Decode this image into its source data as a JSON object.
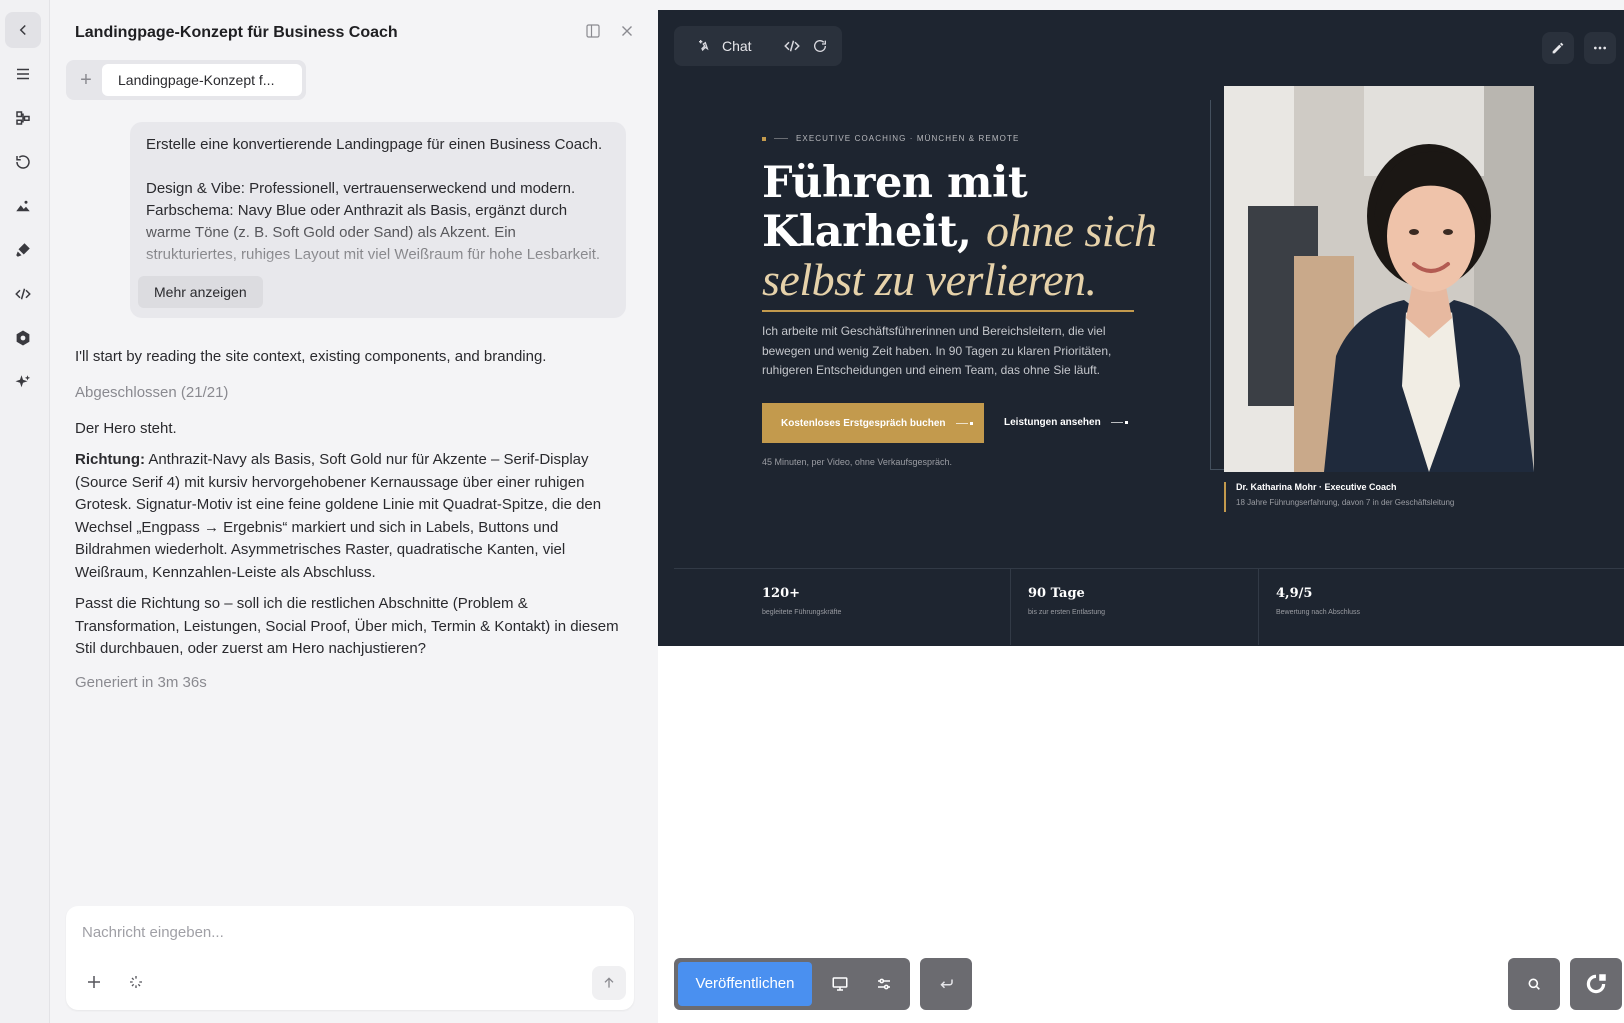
{
  "chat": {
    "title": "Landingpage-Konzept für Business Coach",
    "tab_label": "Landingpage-Konzept f...",
    "user_message": {
      "p1": "Erstelle eine konvertierende Landingpage für einen Business Coach.",
      "p2": "Design & Vibe: Professionell, vertrauenserweckend und modern. Farbschema: Navy Blue oder Anthrazit als Basis, ergänzt durch warme Töne (z. B. Soft Gold oder Sand) als Akzent. Ein strukturiertes, ruhiges Layout mit viel Weißraum für hohe Lesbarkeit.",
      "more_label": "Mehr anzeigen"
    },
    "assistant": {
      "intro": "I'll start by reading the site context, existing components, and branding.",
      "status": "Abgeschlossen (21/21)",
      "hero_done": "Der Hero steht.",
      "direction_label": "Richtung:",
      "direction_text": " Anthrazit-Navy als Basis, Soft Gold nur für Akzente – Serif-Display (Source Serif 4) mit kursiv hervorgehobener Kernaussage über einer ruhigen Grotesk. Signatur-Motiv ist eine feine goldene Linie mit Quadrat-Spitze, die den Wechsel „Engpass → Ergebnis“ markiert und sich in Labels, Buttons und Bildrahmen wiederholt. Asymmetrisches Raster, quadratische Kanten, viel Weißraum, Kennzahlen-Leiste als Abschluss.",
      "question": "Passt die Richtung so – soll ich die restlichen Abschnitte (Problem & Transformation, Leistungen, Social Proof, Über mich, Termin & Kontakt) in diesem Stil durchbauen, oder zuerst am Hero nachjustieren?",
      "generated": "Generiert in 3m 36s"
    },
    "composer": {
      "placeholder": "Nachricht eingeben..."
    }
  },
  "preview_toolbar": {
    "chat_label": "Chat"
  },
  "hero": {
    "eyebrow": "EXECUTIVE COACHING · MÜNCHEN & REMOTE",
    "headline_line1": "Führen mit",
    "headline_line2_plain": "Klarheit, ",
    "headline_line2_accent": "ohne sich",
    "headline_line3_accent": "selbst zu verlieren.",
    "lead": "Ich arbeite mit Geschäftsführerinnen und Bereichsleitern, die viel bewegen und wenig Zeit haben. In 90 Tagen zu klaren Prioritäten, ruhigeren Entscheidungen und einem Team, das ohne Sie läuft.",
    "cta_primary": "Kostenloses Erstgespräch buchen",
    "cta_secondary": "Leistungen ansehen",
    "fineprint": "45 Minuten, per Video, ohne Verkaufsgespräch.",
    "caption_name": "Dr. Katharina Mohr · Executive Coach",
    "caption_sub": "18 Jahre Führungserfahrung, davon 7 in der Geschäftsleitung",
    "stats": [
      {
        "value": "120+",
        "label": "begleitete Führungskräfte"
      },
      {
        "value": "90 Tage",
        "label": "bis zur ersten Entlastung"
      },
      {
        "value": "4,9/5",
        "label": "Bewertung nach Abschluss"
      }
    ]
  },
  "bottom_toolbar": {
    "publish_label": "Veröffentlichen"
  },
  "colors": {
    "navy": "#1e2530",
    "gold": "#c39a4d",
    "sand_accent": "#e6d2aa",
    "publish_blue": "#4a90f0"
  }
}
